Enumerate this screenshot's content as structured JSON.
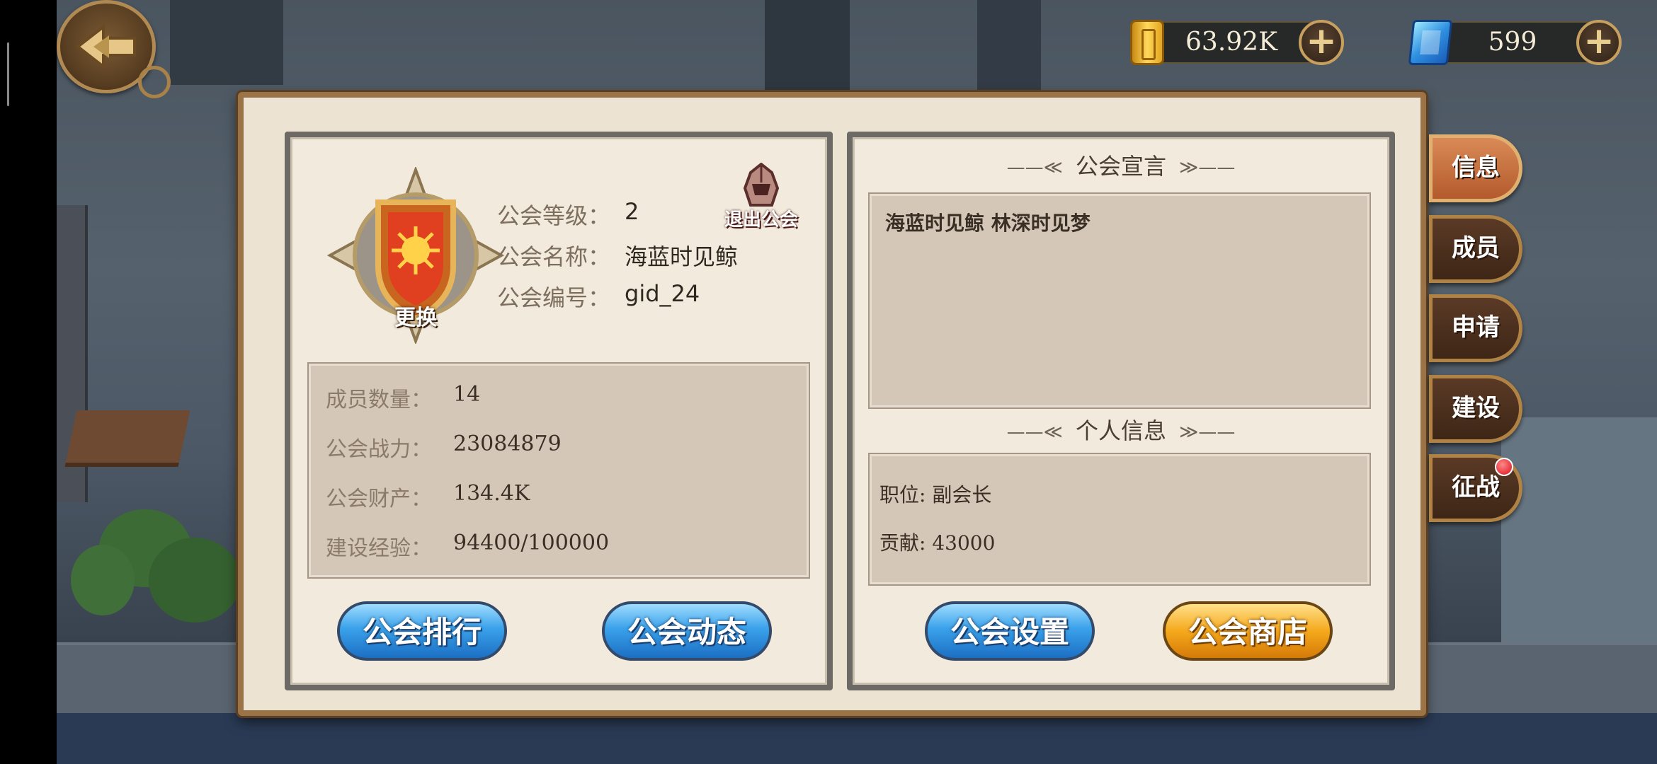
{
  "currency": {
    "gold": {
      "icon": "gold-bar-icon",
      "value": "63.92K"
    },
    "gems": {
      "icon": "blue-gem-icon",
      "value": "599"
    },
    "plus_symbol": "+"
  },
  "guild": {
    "emblem_change_label": "更换",
    "quit_label": "退出公会",
    "info": [
      {
        "label": "公会等级：",
        "value": "2"
      },
      {
        "label": "公会名称：",
        "value": "海蓝时见鲸"
      },
      {
        "label": "公会编号：",
        "value": "gid_24"
      }
    ],
    "stats": [
      {
        "label": "成员数量：",
        "value": "14"
      },
      {
        "label": "公会战力：",
        "value": "23084879"
      },
      {
        "label": "公会财产：",
        "value": "134.4K"
      },
      {
        "label": "建设经验：",
        "value": "94400/100000"
      }
    ],
    "buttons": {
      "rank": "公会排行",
      "news": "公会动态",
      "settings": "公会设置",
      "shop": "公会商店"
    }
  },
  "declaration": {
    "title": "公会宣言",
    "text": "海蓝时见鲸 林深时见梦"
  },
  "personal": {
    "title": "个人信息",
    "position": "职位: 副会长",
    "contribution": "贡献: 43000"
  },
  "title_deco_left": "——≪",
  "title_deco_right": "≫——",
  "tabs": [
    {
      "label": "信息",
      "active": true
    },
    {
      "label": "成员",
      "active": false
    },
    {
      "label": "申请",
      "active": false
    },
    {
      "label": "建设",
      "active": false
    },
    {
      "label": "征战",
      "active": false,
      "badge": true
    }
  ],
  "colors": {
    "panel_bg": "#ece3d2",
    "panel_border": "#9a7346",
    "box_bg": "#d5c7b8",
    "button_blue": "#3aa2ea",
    "button_orange": "#f5a91c",
    "tab_active": "#c8703f",
    "badge_red": "#d8101a"
  }
}
